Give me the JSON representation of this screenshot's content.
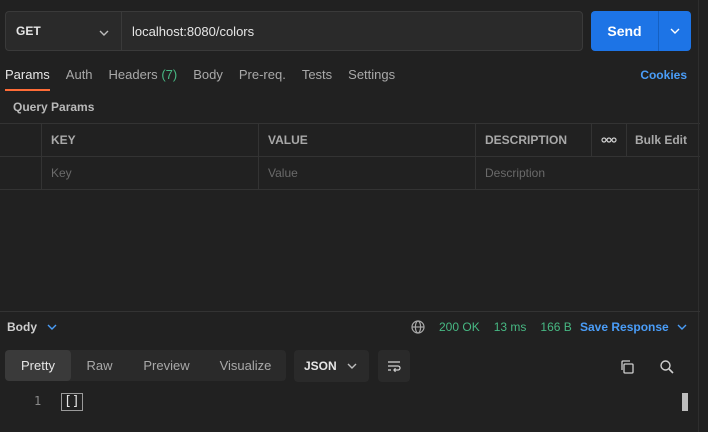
{
  "request": {
    "method": "GET",
    "url": "localhost:8080/colors",
    "send_label": "Send"
  },
  "tabs": [
    {
      "label": "Params",
      "active": true
    },
    {
      "label": "Auth",
      "active": false
    },
    {
      "label": "Headers",
      "count": "(7)",
      "active": false
    },
    {
      "label": "Body",
      "active": false
    },
    {
      "label": "Pre-req.",
      "active": false
    },
    {
      "label": "Tests",
      "active": false
    },
    {
      "label": "Settings",
      "active": false
    }
  ],
  "cookies_label": "Cookies",
  "query_params": {
    "title": "Query Params",
    "headers": {
      "key": "KEY",
      "value": "VALUE",
      "description": "DESCRIPTION",
      "bulk_edit": "Bulk Edit"
    },
    "placeholders": {
      "key": "Key",
      "value": "Value",
      "description": "Description"
    }
  },
  "response": {
    "body_label": "Body",
    "status": "200 OK",
    "time": "13 ms",
    "size": "166 B",
    "save_label": "Save Response",
    "view_tabs": [
      {
        "label": "Pretty",
        "active": true
      },
      {
        "label": "Raw",
        "active": false
      },
      {
        "label": "Preview",
        "active": false
      },
      {
        "label": "Visualize",
        "active": false
      }
    ],
    "format": "JSON",
    "line_number": "1",
    "code": "[]"
  },
  "colors": {
    "accent": "#ff6c37",
    "primary": "#1d74e6",
    "link": "#4a9df8",
    "success": "#47b883"
  },
  "icons": [
    "chevron-down-icon",
    "globe-icon",
    "wrap-lines-icon",
    "copy-icon",
    "search-icon",
    "more-horizontal-icon"
  ]
}
